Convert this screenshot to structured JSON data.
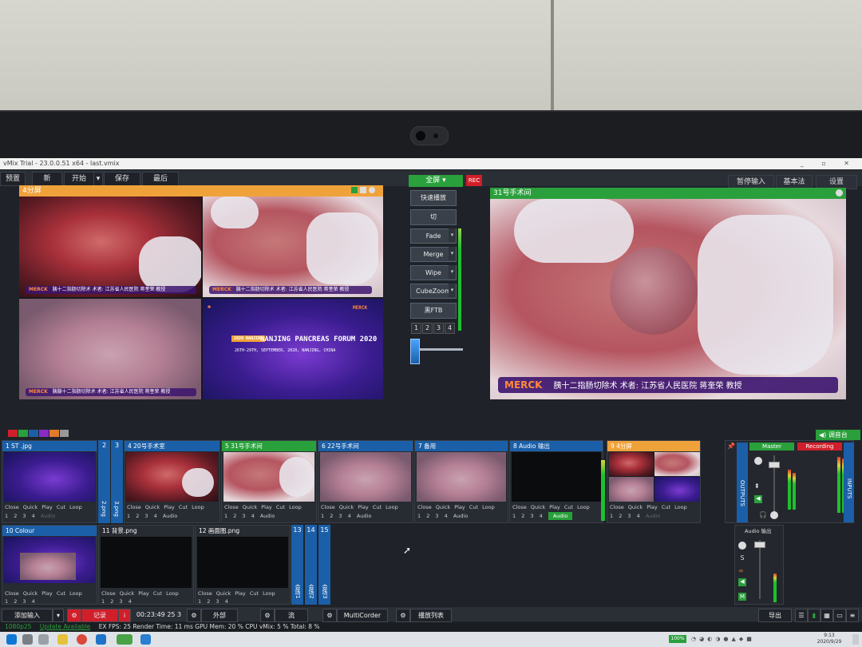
{
  "window": {
    "title": "vMix Trial - 23.0.0.51 x64 - last.vmix",
    "controls": "_ ▫ ✕"
  },
  "menu": {
    "preview": "预置",
    "new": "新",
    "open": "开始",
    "open_arrow": "▾",
    "save": "保存",
    "last": "最后",
    "pause_input": "暂停输入",
    "basic": "基本法",
    "settings": "设置"
  },
  "preview_panel": {
    "title": "4分屏",
    "quad_captions": [
      "胰十二指肠切除术  术者: 江苏省人民医院 蒋奎荣 教授",
      "胰十二指肠切除术  术者: 江苏省人民医院 蒋奎荣 教授",
      "胰腺十二指肠切除术  术者: 江苏省人民医院 蒋奎荣 教授"
    ],
    "merck": "MERCK",
    "forum_title": "NANJING PANCREAS FORUM 2020",
    "forum_dates": "26TH-29TH, SEPTEMBER, 2020, NANJING, CHINA",
    "forum_tag": "2020 NANJING"
  },
  "output_panel": {
    "title": "31号手术间",
    "caption_brand": "MERCK",
    "caption_text": "胰十二指肠切除术  术者: 江苏省人民医院  蒋奎荣 教授"
  },
  "transitions": {
    "go_label": "全屏",
    "go_arrow": "▾",
    "rec": "REC",
    "quick_play": "快速播放",
    "cut": "切",
    "buttons": [
      "Fade",
      "Merge",
      "Wipe",
      "CubeZoom"
    ],
    "ftb": "黑FTB",
    "numbers": [
      "1",
      "2",
      "3",
      "4"
    ],
    "arrow": "▾"
  },
  "inputs": {
    "controls": "Close  Quick Play  Cut  Loop",
    "numbers": "1  2  3  4",
    "audio": "Audio",
    "items": [
      {
        "id": "1",
        "name": "1  ST .jpg"
      },
      {
        "id": "4",
        "name": "4  20号手术室"
      },
      {
        "id": "5",
        "name": "5  31号手术间"
      },
      {
        "id": "6",
        "name": "6  22号手术间"
      },
      {
        "id": "7",
        "name": "7  备用"
      },
      {
        "id": "8",
        "name": "8  Audio 输出"
      },
      {
        "id": "9",
        "name": "9  4分屏"
      },
      {
        "id": "10",
        "name": "10  Colour"
      },
      {
        "id": "11",
        "name": "11  背景.png"
      },
      {
        "id": "12",
        "name": "12  画面图.png"
      }
    ],
    "narrow": [
      {
        "id": "2",
        "label": "2",
        "vlabel": "2.png"
      },
      {
        "id": "3",
        "label": "3",
        "vlabel": "3.png"
      },
      {
        "id": "13",
        "label": "13",
        "vlabel": "会场1"
      },
      {
        "id": "14",
        "label": "14",
        "vlabel": "会场2"
      },
      {
        "id": "15",
        "label": "15",
        "vlabel": "会场3"
      }
    ]
  },
  "audio_mixer": {
    "master": "Master",
    "recording": "Recording",
    "outputs": "OUTPUTS",
    "inputs": "INPUTS",
    "audio_out": "Audio 输出",
    "s": "S",
    "m": "M",
    "mix_btn": "调音台",
    "speaker_icon": "speaker-icon"
  },
  "bottom_bar": {
    "add_input": "添加输入",
    "add_arrow": "▾",
    "record": "记录",
    "timecode": "00:23:49 25 3",
    "external": "外部",
    "stream": "流",
    "multicorder": "MultiCorder",
    "playlist": "播放列表",
    "export": "导出"
  },
  "status": {
    "format": "1080p25",
    "update": "Update Available",
    "stats": "EX   FPS: 25   Render Time: 11 ms   GPU Mem: 20 %   CPU vMix: 5 %   Total: 8 %"
  },
  "taskbar": {
    "time": "9:13",
    "date": "2020/9/29",
    "battery": "100%"
  },
  "colors": {
    "orange": "#f0a23a",
    "green": "#2aa03c",
    "blue": "#1b5fa8",
    "rec_red": "#d01f2a"
  }
}
